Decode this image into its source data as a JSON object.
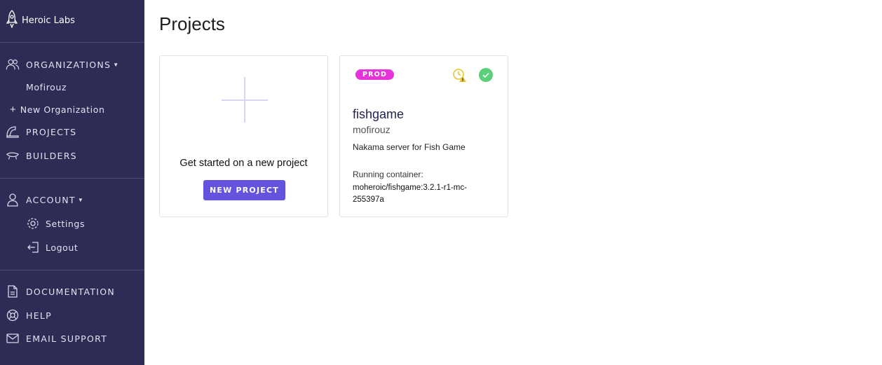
{
  "brand": {
    "name": "Heroic Labs"
  },
  "sidebar": {
    "organizations": {
      "label": "ORGANIZATIONS",
      "items": [
        "Mofirouz"
      ],
      "new_label": "New Organization"
    },
    "projects_label": "PROJECTS",
    "builders_label": "BUILDERS",
    "account": {
      "label": "ACCOUNT",
      "settings_label": "Settings",
      "logout_label": "Logout"
    },
    "documentation_label": "DOCUMENTATION",
    "help_label": "HELP",
    "email_support_label": "EMAIL SUPPORT"
  },
  "main": {
    "title": "Projects",
    "new_card": {
      "text": "Get started on a new project",
      "button_label": "NEW PROJECT"
    },
    "projects": [
      {
        "badge": "PROD",
        "name": "fishgame",
        "owner": "mofirouz",
        "description": "Nakama server for Fish Game",
        "container_label": "Running container:",
        "container_value": "moheroic/fishgame:3.2.1-r1-mc-255397a",
        "status_icons": [
          "clock-warning-icon",
          "check-circle-icon"
        ]
      }
    ]
  },
  "colors": {
    "sidebar_bg": "#2e2b55",
    "accent": "#6453df",
    "badge_prod": "#e733dc",
    "warning": "#e5c22b",
    "success": "#5ccf7a"
  }
}
